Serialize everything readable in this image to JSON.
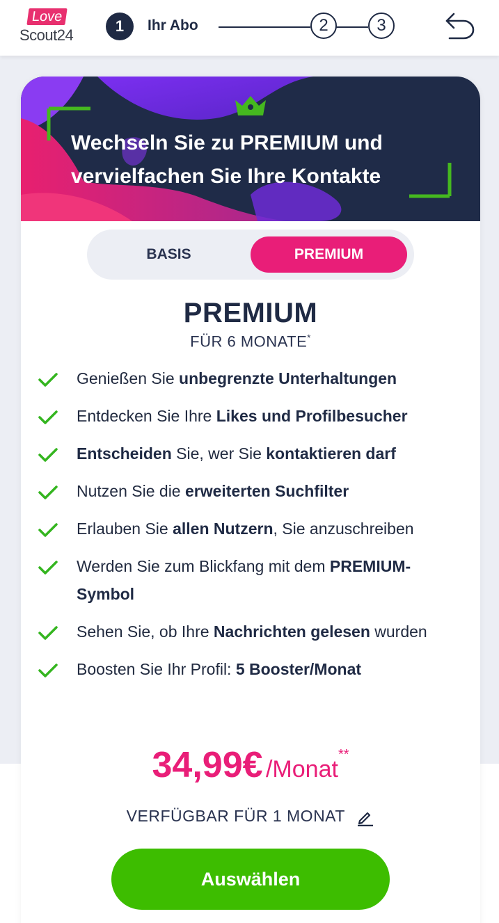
{
  "header": {
    "logo_love": "Love",
    "logo_scout": "Scout24",
    "steps": [
      {
        "number": "1",
        "label": "Ihr Abo",
        "active": true
      },
      {
        "number": "2"
      },
      {
        "number": "3"
      }
    ],
    "back_icon": "back-arrow-icon"
  },
  "banner": {
    "icon": "crown-icon",
    "headline_line1": "Wechseln Sie zu PREMIUM und",
    "headline_line2": "vervielfachen Sie Ihre Kontakte"
  },
  "toggle": {
    "options": [
      "BASIS",
      "PREMIUM"
    ],
    "selected": "PREMIUM"
  },
  "plan": {
    "title": "PREMIUM",
    "duration": "FÜR 6 MONATE",
    "duration_marker": "*"
  },
  "features": [
    {
      "parts": [
        {
          "t": "Genießen Sie "
        },
        {
          "t": "unbegrenzte Unterhaltungen",
          "b": true
        }
      ]
    },
    {
      "parts": [
        {
          "t": "Entdecken Sie Ihre "
        },
        {
          "t": "Likes und Profilbesucher",
          "b": true
        }
      ]
    },
    {
      "parts": [
        {
          "t": "Entscheiden",
          "b": true
        },
        {
          "t": " Sie, wer Sie "
        },
        {
          "t": "kontaktieren darf",
          "b": true
        }
      ]
    },
    {
      "parts": [
        {
          "t": "Nutzen Sie die "
        },
        {
          "t": "erweiterten Suchfilter",
          "b": true
        }
      ]
    },
    {
      "parts": [
        {
          "t": "Erlauben Sie "
        },
        {
          "t": "allen Nutzern",
          "b": true
        },
        {
          "t": ", Sie anzuschreiben"
        }
      ]
    },
    {
      "parts": [
        {
          "t": "Werden Sie zum Blickfang mit dem "
        },
        {
          "t": "PREMIUM-Symbol",
          "b": true
        }
      ]
    },
    {
      "parts": [
        {
          "t": "Sehen Sie, ob Ihre "
        },
        {
          "t": "Nachrichten gelesen",
          "b": true
        },
        {
          "t": " wurden"
        }
      ]
    },
    {
      "parts": [
        {
          "t": "Boosten Sie Ihr Profil: "
        },
        {
          "t": "5 Booster/Monat",
          "b": true
        }
      ]
    }
  ],
  "price": {
    "amount": "34,99€",
    "period": "/Monat",
    "marker": "**"
  },
  "availability": {
    "text": "VERFÜGBAR FÜR 1 MONAT",
    "icon": "pencil-edit-icon"
  },
  "cta": {
    "label": "Auswählen"
  },
  "colors": {
    "accent_pink": "#e91e78",
    "cta_green": "#3dbd00",
    "navy": "#1f2a44",
    "check_green": "#34b51f"
  }
}
